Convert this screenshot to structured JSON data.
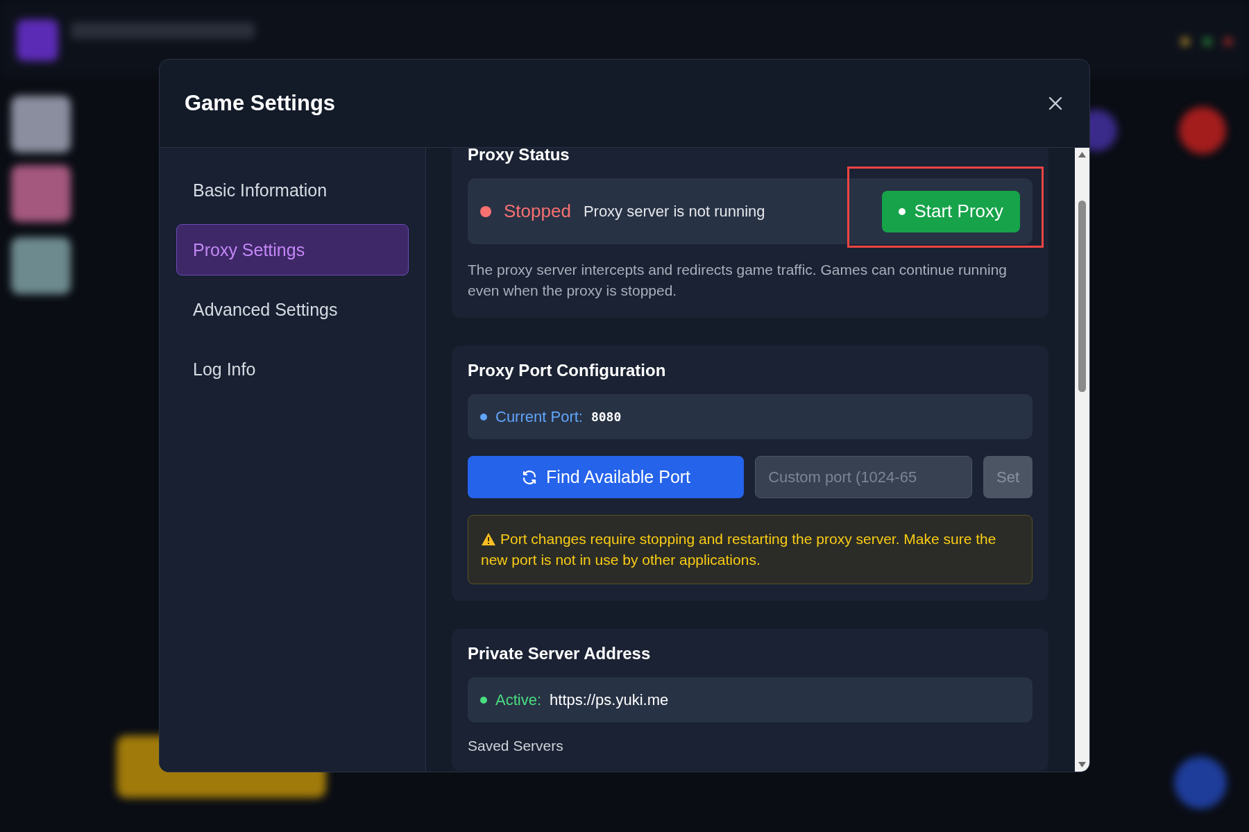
{
  "dialog": {
    "title": "Game Settings"
  },
  "sidebar": {
    "items": [
      {
        "label": "Basic Information",
        "selected": false
      },
      {
        "label": "Proxy Settings",
        "selected": true
      },
      {
        "label": "Advanced Settings",
        "selected": false
      },
      {
        "label": "Log Info",
        "selected": false
      }
    ]
  },
  "proxy_status": {
    "title": "Proxy Status",
    "running": false,
    "status": "Stopped",
    "message": "Proxy server is not running",
    "button": "Start Proxy",
    "highlighted": true,
    "description": "The proxy server intercepts and redirects game traffic. Games can continue running even when the proxy is stopped."
  },
  "port_config": {
    "title": "Proxy Port Configuration",
    "current_port_label": "Current Port:",
    "current_port": "8080",
    "find_button": "Find Available Port",
    "custom_port": {
      "placeholder": "Custom port (1024-65"
    },
    "set_button": "Set",
    "set_disabled": true,
    "warning": "Port changes require stopping and restarting the proxy server. Make sure the new port is not in use by other applications."
  },
  "private_server": {
    "title": "Private Server Address",
    "active": true,
    "status_label": "Active:",
    "address": "https://ps.yuki.me",
    "saved_servers_label": "Saved Servers"
  }
}
